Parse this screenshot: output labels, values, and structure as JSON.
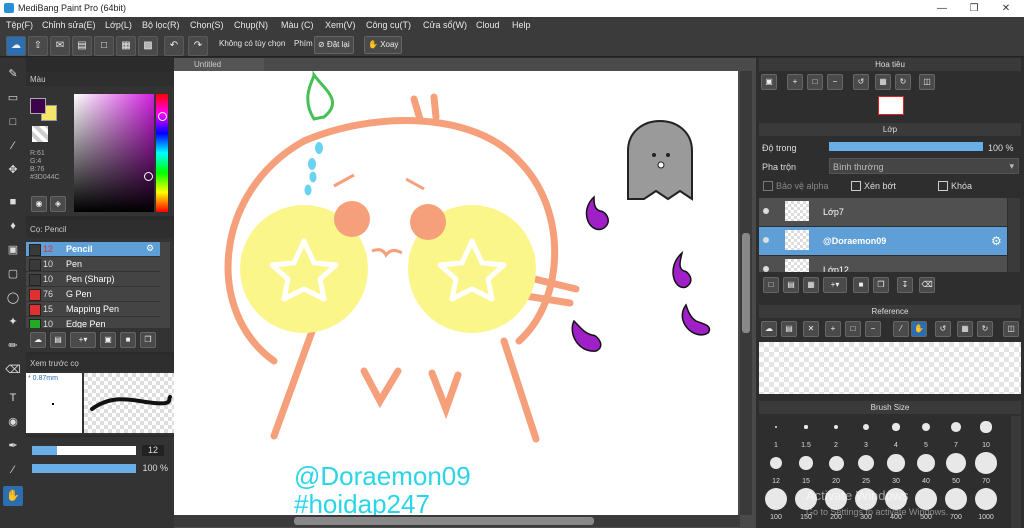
{
  "window": {
    "title": "MediBang Paint Pro (64bit)"
  },
  "menu": [
    "Tệp(F)",
    "Chỉnh sửa(E)",
    "Lớp(L)",
    "Bộ lọc(R)",
    "Chọn(S)",
    "Chụp(N)",
    "Màu (C)",
    "Xem(V)",
    "Công cụ(T)",
    "Cửa sổ(W)",
    "Cloud",
    "Help"
  ],
  "toolbar": {
    "no_option": "Không có tùy chọn",
    "key_label": "Phím",
    "reset": "Đặt lại",
    "rotate": "Xoay"
  },
  "canvas": {
    "tab": "Untitled",
    "text_line1": "@Doraemon09",
    "text_line2": "#hoidap247"
  },
  "color_panel": {
    "title": "Màu",
    "r": "R:61",
    "g": "G:4",
    "b": "B:76",
    "hex": "#3D044C",
    "primary_color": "#3D044C",
    "secondary_color": "#F5E56B"
  },
  "brush_panel": {
    "title": "Cọ: Pencil",
    "items": [
      {
        "size": "12",
        "name": "Pencil",
        "color": "#3a3a3a",
        "selected": true
      },
      {
        "size": "10",
        "name": "Pen",
        "color": "#3a3a3a"
      },
      {
        "size": "10",
        "name": "Pen (Sharp)",
        "color": "#3a3a3a"
      },
      {
        "size": "76",
        "name": "G Pen",
        "color": "#e03030"
      },
      {
        "size": "15",
        "name": "Mapping Pen",
        "color": "#e03030"
      },
      {
        "size": "10",
        "name": "Edge Pen",
        "color": "#22aa22"
      }
    ]
  },
  "preview_panel": {
    "title": "Xem trước cọ",
    "size": "* 0.87mm"
  },
  "sliders": {
    "size": "12",
    "opacity": "100 %",
    "size_fraction": 0.12,
    "opacity_fraction": 1.0
  },
  "navigator": {
    "title": "Hoa tiêu"
  },
  "layer_panel": {
    "title": "Lớp",
    "opacity_label": "Độ trong",
    "opacity": "100 %",
    "blend_label": "Pha trộn",
    "blend": "Bình thường",
    "protect_alpha": "Bảo vệ alpha",
    "clipping": "Xén bớt",
    "lock": "Khóa",
    "layers": [
      {
        "name": "Lớp7",
        "selected": false
      },
      {
        "name": "@Doraemon09",
        "selected": true
      },
      {
        "name": "Lớp12",
        "selected": false
      }
    ]
  },
  "reference_panel": {
    "title": "Reference"
  },
  "brush_size_panel": {
    "title": "Brush Size",
    "row1": [
      "1",
      "1.5",
      "2",
      "3",
      "4",
      "5",
      "7",
      "10"
    ],
    "row2": [
      "12",
      "15",
      "20",
      "25",
      "30",
      "40",
      "50",
      "70"
    ],
    "row3": [
      "100",
      "150",
      "200",
      "300",
      "400",
      "500",
      "700",
      "1000"
    ]
  },
  "watermark": {
    "line1": "Activate Windows",
    "line2": "Go to Settings to activate Windows."
  }
}
